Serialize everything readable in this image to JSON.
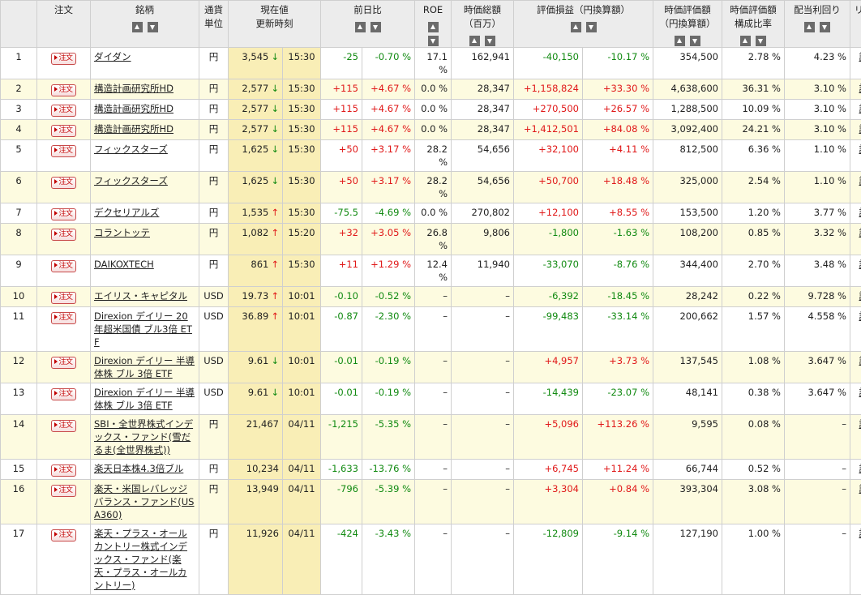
{
  "headers": {
    "order": "注文",
    "name": "銘柄",
    "currency": "通貨単位",
    "price": "現在値",
    "update": "更新時刻",
    "change": "前日比",
    "roe": "ROE",
    "mcap": "時価総額（百万）",
    "pl": "評価損益（円換算額）",
    "value": "時価評価額（円換算額）",
    "ratio": "時価評価額構成比率",
    "yield": "配当利回り",
    "link": "リンク"
  },
  "order_label": "注文",
  "link_label": "詳細",
  "colors": {
    "positive": "#e01818",
    "negative": "#118a11",
    "price_bg": "#f9eeb6",
    "row_alt_bg": "#fdfbe0"
  },
  "rows": [
    {
      "no": "1",
      "name": "ダイダン",
      "cur": "円",
      "price": "3,545",
      "dir": "down",
      "time": "15:30",
      "chg": "-25",
      "chgp": "-0.70 %",
      "roe": "17.1 %",
      "mcap": "162,941",
      "pl": "-40,150",
      "plp": "-10.17 %",
      "val": "354,500",
      "ratio": "2.78 %",
      "yield": "4.23 %"
    },
    {
      "no": "2",
      "name": "構造計画研究所HD",
      "cur": "円",
      "price": "2,577",
      "dir": "down",
      "time": "15:30",
      "chg": "+115",
      "chgp": "+4.67 %",
      "roe": "0.0 %",
      "mcap": "28,347",
      "pl": "+1,158,824",
      "plp": "+33.30 %",
      "val": "4,638,600",
      "ratio": "36.31 %",
      "yield": "3.10 %"
    },
    {
      "no": "3",
      "name": "構造計画研究所HD",
      "cur": "円",
      "price": "2,577",
      "dir": "down",
      "time": "15:30",
      "chg": "+115",
      "chgp": "+4.67 %",
      "roe": "0.0 %",
      "mcap": "28,347",
      "pl": "+270,500",
      "plp": "+26.57 %",
      "val": "1,288,500",
      "ratio": "10.09 %",
      "yield": "3.10 %"
    },
    {
      "no": "4",
      "name": "構造計画研究所HD",
      "cur": "円",
      "price": "2,577",
      "dir": "down",
      "time": "15:30",
      "chg": "+115",
      "chgp": "+4.67 %",
      "roe": "0.0 %",
      "mcap": "28,347",
      "pl": "+1,412,501",
      "plp": "+84.08 %",
      "val": "3,092,400",
      "ratio": "24.21 %",
      "yield": "3.10 %"
    },
    {
      "no": "5",
      "name": "フィックスターズ",
      "cur": "円",
      "price": "1,625",
      "dir": "down",
      "time": "15:30",
      "chg": "+50",
      "chgp": "+3.17 %",
      "roe": "28.2 %",
      "mcap": "54,656",
      "pl": "+32,100",
      "plp": "+4.11 %",
      "val": "812,500",
      "ratio": "6.36 %",
      "yield": "1.10 %"
    },
    {
      "no": "6",
      "name": "フィックスターズ",
      "cur": "円",
      "price": "1,625",
      "dir": "down",
      "time": "15:30",
      "chg": "+50",
      "chgp": "+3.17 %",
      "roe": "28.2 %",
      "mcap": "54,656",
      "pl": "+50,700",
      "plp": "+18.48 %",
      "val": "325,000",
      "ratio": "2.54 %",
      "yield": "1.10 %"
    },
    {
      "no": "7",
      "name": "デクセリアルズ",
      "cur": "円",
      "price": "1,535",
      "dir": "up",
      "time": "15:30",
      "chg": "-75.5",
      "chgp": "-4.69 %",
      "roe": "0.0 %",
      "mcap": "270,802",
      "pl": "+12,100",
      "plp": "+8.55 %",
      "val": "153,500",
      "ratio": "1.20 %",
      "yield": "3.77 %"
    },
    {
      "no": "8",
      "name": "コラントッテ",
      "cur": "円",
      "price": "1,082",
      "dir": "up",
      "time": "15:20",
      "chg": "+32",
      "chgp": "+3.05 %",
      "roe": "26.8 %",
      "mcap": "9,806",
      "pl": "-1,800",
      "plp": "-1.63 %",
      "val": "108,200",
      "ratio": "0.85 %",
      "yield": "3.32 %"
    },
    {
      "no": "9",
      "name": "DAIKOXTECH",
      "cur": "円",
      "price": "861",
      "dir": "up",
      "time": "15:30",
      "chg": "+11",
      "chgp": "+1.29 %",
      "roe": "12.4 %",
      "mcap": "11,940",
      "pl": "-33,070",
      "plp": "-8.76 %",
      "val": "344,400",
      "ratio": "2.70 %",
      "yield": "3.48 %"
    },
    {
      "no": "10",
      "name": "エイリス・キャピタル",
      "cur": "USD",
      "price": "19.73",
      "dir": "up",
      "time": "10:01",
      "chg": "-0.10",
      "chgp": "-0.52 %",
      "roe": "–",
      "mcap": "–",
      "pl": "-6,392",
      "plp": "-18.45 %",
      "val": "28,242",
      "ratio": "0.22 %",
      "yield": "9.728 %"
    },
    {
      "no": "11",
      "name": "Direxion デイリー 20年超米国債 ブル3倍 ETF",
      "cur": "USD",
      "price": "36.89",
      "dir": "up",
      "time": "10:01",
      "chg": "-0.87",
      "chgp": "-2.30 %",
      "roe": "–",
      "mcap": "–",
      "pl": "-99,483",
      "plp": "-33.14 %",
      "val": "200,662",
      "ratio": "1.57 %",
      "yield": "4.558 %"
    },
    {
      "no": "12",
      "name": "Direxion デイリー 半導体株 ブル 3倍 ETF",
      "cur": "USD",
      "price": "9.61",
      "dir": "down",
      "time": "10:01",
      "chg": "-0.01",
      "chgp": "-0.19 %",
      "roe": "–",
      "mcap": "–",
      "pl": "+4,957",
      "plp": "+3.73 %",
      "val": "137,545",
      "ratio": "1.08 %",
      "yield": "3.647 %"
    },
    {
      "no": "13",
      "name": "Direxion デイリー 半導体株 ブル 3倍 ETF",
      "cur": "USD",
      "price": "9.61",
      "dir": "down",
      "time": "10:01",
      "chg": "-0.01",
      "chgp": "-0.19 %",
      "roe": "–",
      "mcap": "–",
      "pl": "-14,439",
      "plp": "-23.07 %",
      "val": "48,141",
      "ratio": "0.38 %",
      "yield": "3.647 %"
    },
    {
      "no": "14",
      "name": "SBI・全世界株式インデックス・ファンド(雪だるま(全世界株式))",
      "cur": "円",
      "price": "21,467",
      "dir": "",
      "time": "04/11",
      "chg": "-1,215",
      "chgp": "-5.35 %",
      "roe": "–",
      "mcap": "–",
      "pl": "+5,096",
      "plp": "+113.26 %",
      "val": "9,595",
      "ratio": "0.08 %",
      "yield": "–"
    },
    {
      "no": "15",
      "name": "楽天日本株4.3倍ブル",
      "cur": "円",
      "price": "10,234",
      "dir": "",
      "time": "04/11",
      "chg": "-1,633",
      "chgp": "-13.76 %",
      "roe": "–",
      "mcap": "–",
      "pl": "+6,745",
      "plp": "+11.24 %",
      "val": "66,744",
      "ratio": "0.52 %",
      "yield": "–"
    },
    {
      "no": "16",
      "name": "楽天・米国レバレッジバランス・ファンド(USA360)",
      "cur": "円",
      "price": "13,949",
      "dir": "",
      "time": "04/11",
      "chg": "-796",
      "chgp": "-5.39 %",
      "roe": "–",
      "mcap": "–",
      "pl": "+3,304",
      "plp": "+0.84 %",
      "val": "393,304",
      "ratio": "3.08 %",
      "yield": "–"
    },
    {
      "no": "17",
      "name": "楽天・プラス・オールカントリー株式インデックス・ファンド(楽天・プラス・オールカントリー)",
      "cur": "円",
      "price": "11,926",
      "dir": "",
      "time": "04/11",
      "chg": "-424",
      "chgp": "-3.43 %",
      "roe": "–",
      "mcap": "–",
      "pl": "-12,809",
      "plp": "-9.14 %",
      "val": "127,190",
      "ratio": "1.00 %",
      "yield": "–"
    }
  ]
}
